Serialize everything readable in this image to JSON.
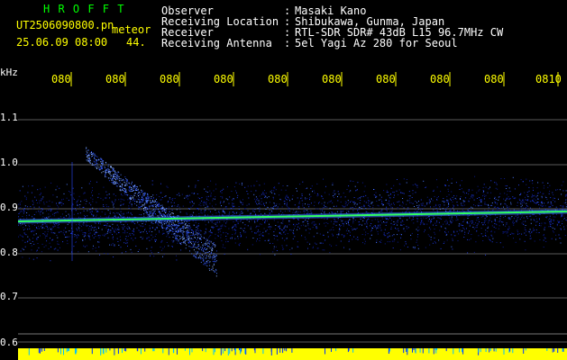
{
  "app": {
    "brand": "H R O F F T",
    "filename": "UT2506090800.pn",
    "event_type": "meteor",
    "datetime": "25.06.09 08:00",
    "count": "44."
  },
  "station": {
    "rows": [
      {
        "label": "Observer",
        "sep": ":",
        "value": "Masaki Kano"
      },
      {
        "label": "Receiving Location",
        "sep": ":",
        "value": "Shibukawa, Gunma, Japan"
      },
      {
        "label": "Receiver",
        "sep": ":",
        "value": "RTL-SDR SDR# 43dB L15 96.7MHz CW"
      },
      {
        "label": "Receiving Antenna",
        "sep": ":",
        "value": "5el Yagi Az 280 for Seoul"
      }
    ]
  },
  "axis": {
    "y_unit": "kHz",
    "y_ticks": [
      "1.1",
      "1.0",
      "0.9",
      "0.8",
      "0.7",
      "0.6"
    ],
    "x_ticks": [
      "080",
      "080",
      "080",
      "080",
      "080",
      "080",
      "080",
      "080",
      "080",
      "0810"
    ]
  },
  "colors": {
    "background": "#000000",
    "time_tick": "#ffff00",
    "grid": "#5a5a5a",
    "carrier": "#30ff60",
    "noise": "#1a3aff",
    "baseline": "#ffff00"
  }
}
